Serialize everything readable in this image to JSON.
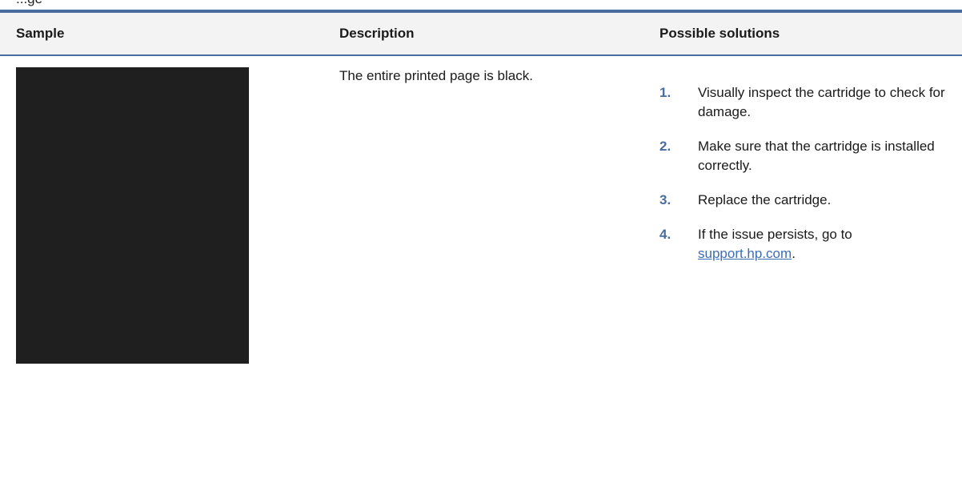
{
  "page_heading_fragment": "...ge",
  "table": {
    "headers": {
      "sample": "Sample",
      "description": "Description",
      "solutions": "Possible solutions"
    },
    "row": {
      "description": "The entire printed page is black.",
      "steps": [
        {
          "num": "1.",
          "text": "Visually inspect the cartridge to check for damage."
        },
        {
          "num": "2.",
          "text": "Make sure that the cartridge is installed correctly."
        },
        {
          "num": "3.",
          "text": "Replace the cartridge."
        },
        {
          "num": "4.",
          "text_before": "If the issue persists, go to ",
          "link": "support.hp.com",
          "text_after": "."
        }
      ]
    }
  },
  "colors": {
    "accent": "#4a6c9e",
    "link": "#3d6db5",
    "sample_fill": "#1f1f1f"
  }
}
